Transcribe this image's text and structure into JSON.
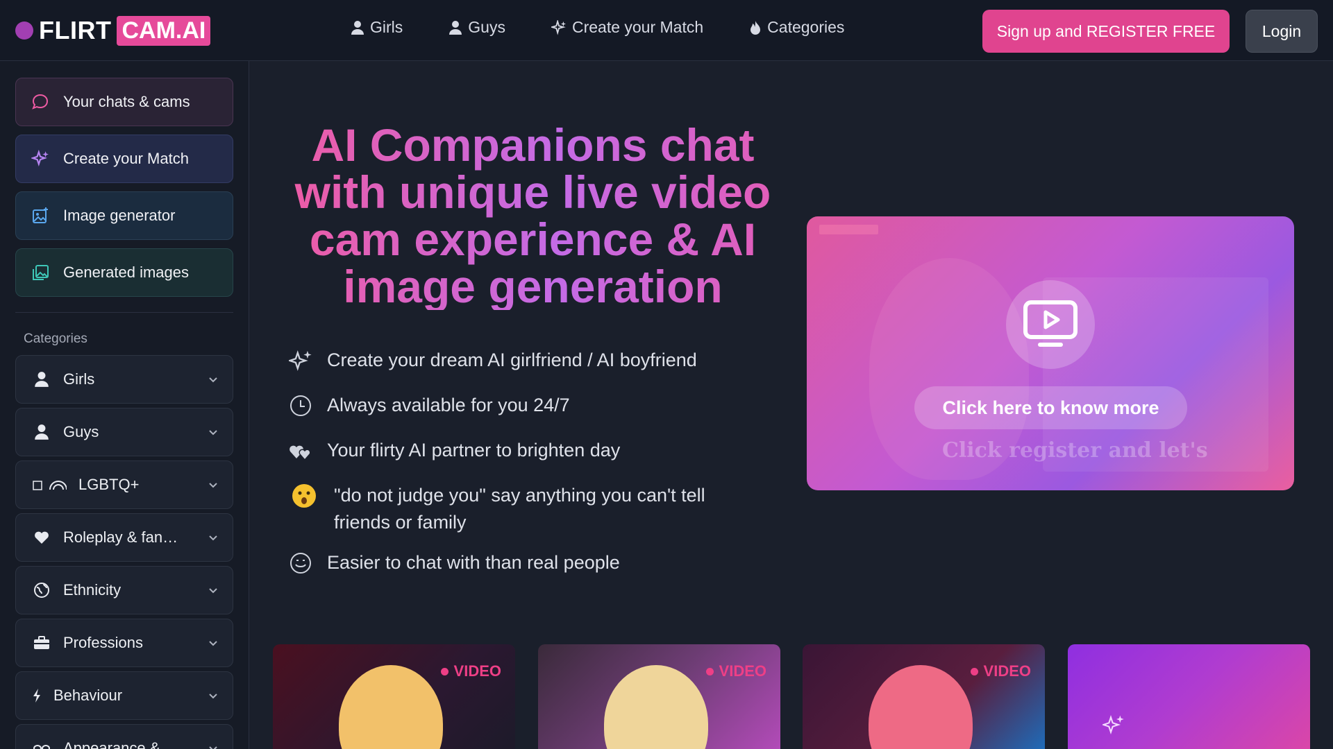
{
  "header": {
    "logo_part1": "FLIRT",
    "logo_part2": "CAM.AI",
    "nav": [
      {
        "label": "Girls",
        "icon": "user-icon"
      },
      {
        "label": "Guys",
        "icon": "user-icon"
      },
      {
        "label": "Create your Match",
        "icon": "sparkle-icon"
      },
      {
        "label": "Categories",
        "icon": "flame-icon"
      }
    ],
    "register_label": "Sign up and REGISTER FREE",
    "login_label": "Login"
  },
  "sidebar": {
    "buttons": [
      {
        "label": "Your chats & cams",
        "icon": "chat-bubble-icon"
      },
      {
        "label": "Create your Match",
        "icon": "sparkle-icon"
      },
      {
        "label": "Image generator",
        "icon": "image-plus-icon"
      },
      {
        "label": "Generated images",
        "icon": "images-icon"
      }
    ],
    "categories_heading": "Categories",
    "categories": [
      {
        "label": "Girls",
        "icon": "user-icon"
      },
      {
        "label": "Guys",
        "icon": "user-icon"
      },
      {
        "label": "LGBTQ+",
        "icon": "rainbow-icon"
      },
      {
        "label": "Roleplay & fan…",
        "icon": "heart-icon"
      },
      {
        "label": "Ethnicity",
        "icon": "globe-icon"
      },
      {
        "label": "Professions",
        "icon": "briefcase-icon"
      },
      {
        "label": "Behaviour",
        "icon": "lightning-icon"
      },
      {
        "label": "Appearance &",
        "icon": "eyes-icon"
      }
    ]
  },
  "hero": {
    "title": "AI Companions chat with unique live video cam experience & AI image generation",
    "features": [
      {
        "text": "Create your dream AI girlfriend / AI boyfriend",
        "icon": "sparkle-icon"
      },
      {
        "text": "Always available for you 24/7",
        "icon": "clock-icon"
      },
      {
        "text": "Your flirty AI partner to brighten day",
        "icon": "hearts-icon"
      },
      {
        "text": "\"do not judge you\" say anything you can't tell friends or family",
        "icon": "hushed-face-icon"
      },
      {
        "text": "Easier to chat with than real people",
        "icon": "smile-icon"
      }
    ]
  },
  "video_card": {
    "button_label": "Click here to know more",
    "overlay_text": "Click register and let's",
    "icon": "play-screen-icon"
  },
  "thumbnails": [
    {
      "badge": "VIDEO"
    },
    {
      "badge": "VIDEO"
    },
    {
      "badge": "VIDEO"
    },
    {
      "badge": ""
    }
  ],
  "colors": {
    "accent_pink": "#e0448f",
    "background": "#1a1f2b",
    "sidebar": "#161b26"
  }
}
